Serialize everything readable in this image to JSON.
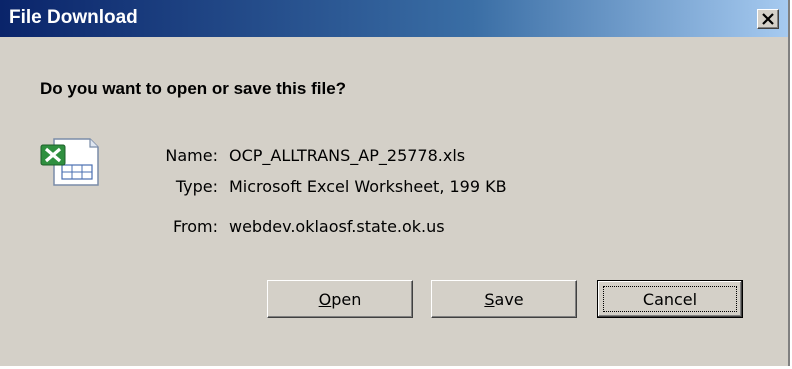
{
  "window": {
    "title": "File Download",
    "close_icon": "close-x-icon"
  },
  "prompt": {
    "question": "Do you want to open or save this file?"
  },
  "file": {
    "icon": "excel-file-icon",
    "name_label": "Name:",
    "name_value": "OCP_ALLTRANS_AP_25778.xls",
    "type_label": "Type:",
    "type_value": "Microsoft Excel Worksheet, 199 KB",
    "from_label": "From:",
    "from_value": "webdev.oklaosf.state.ok.us"
  },
  "buttons": {
    "open": {
      "mnemonic": "O",
      "rest": "pen"
    },
    "save": {
      "mnemonic": "S",
      "rest": "ave"
    },
    "cancel": "Cancel"
  },
  "colors": {
    "titlebar_start": "#0a246a",
    "titlebar_end": "#a6caf0",
    "dialog_face": "#d4d0c8"
  }
}
